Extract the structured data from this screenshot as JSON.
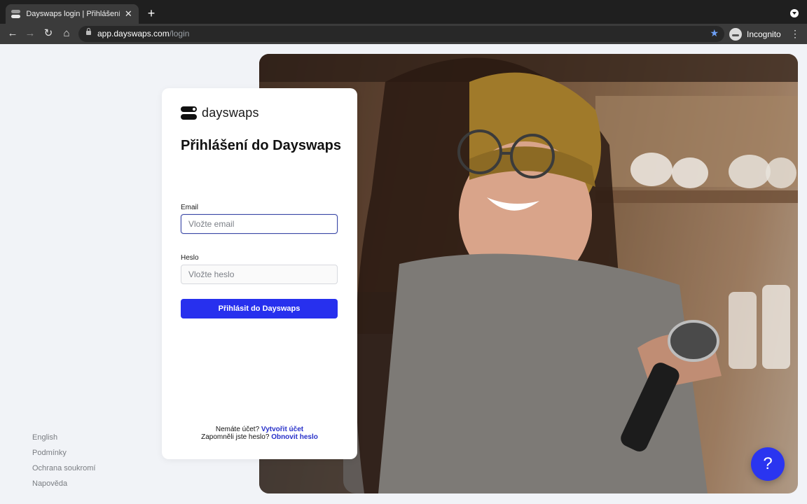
{
  "browser": {
    "tab_title": "Dayswaps login | Přihlášení do Dayswaps",
    "tab_close": "✕",
    "new_tab": "+",
    "url_host": "app.dayswaps.com",
    "url_path": "/login",
    "profile_label": "Incognito"
  },
  "brand": {
    "name": "dayswaps"
  },
  "login": {
    "heading": "Přihlášení do Dayswaps",
    "email_label": "Email",
    "email_placeholder": "Vložte email",
    "email_value": "",
    "password_label": "Heslo",
    "password_placeholder": "Vložte heslo",
    "password_value": "",
    "submit_label": "Přihlásit do Dayswaps",
    "no_account_text": "Nemáte účet?",
    "create_account_link": "Vytvořit účet",
    "forgot_text": "Zapomněli jste heslo?",
    "reset_link": "Obnovit heslo"
  },
  "footer_links": [
    "English",
    "Podmínky",
    "Ochrana soukromí",
    "Napověda"
  ],
  "help_button": "?",
  "colors": {
    "primary": "#2730ee",
    "link": "#2730c9",
    "page_bg": "#f1f3f7"
  }
}
